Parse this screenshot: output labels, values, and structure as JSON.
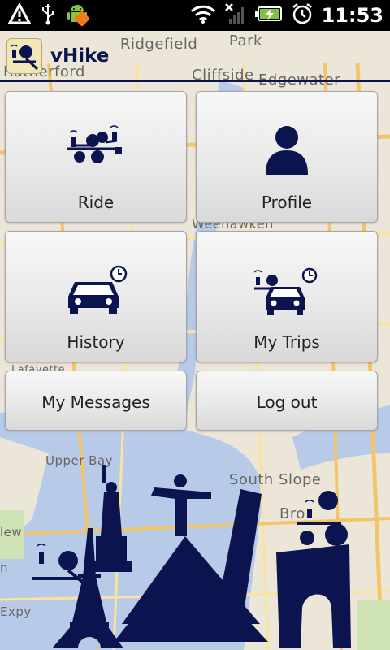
{
  "status_bar": {
    "time": "11:53",
    "icons": [
      "warning-icon",
      "usb-icon",
      "android-debug-icon",
      "wifi-icon",
      "no-signal-icon",
      "battery-charging-icon",
      "alarm-icon"
    ]
  },
  "app": {
    "title": "vHike",
    "accent_color": "#0c1450"
  },
  "map_labels": [
    "Ridgefield",
    "Park",
    "Rutherford",
    "Cliffside",
    "Edgewater",
    "Weehawken",
    "Lafayette",
    "Upper Bay",
    "South Slope",
    "Bro",
    "Expy",
    "lew",
    "n"
  ],
  "menu": {
    "ride": {
      "label": "Ride",
      "icon": "ride-icon"
    },
    "profile": {
      "label": "Profile",
      "icon": "profile-icon"
    },
    "history": {
      "label": "History",
      "icon": "history-car-clock-icon"
    },
    "my_trips": {
      "label": "My Trips",
      "icon": "my-trips-icon"
    },
    "my_messages": {
      "label": "My Messages"
    },
    "log_out": {
      "label": "Log out"
    }
  }
}
